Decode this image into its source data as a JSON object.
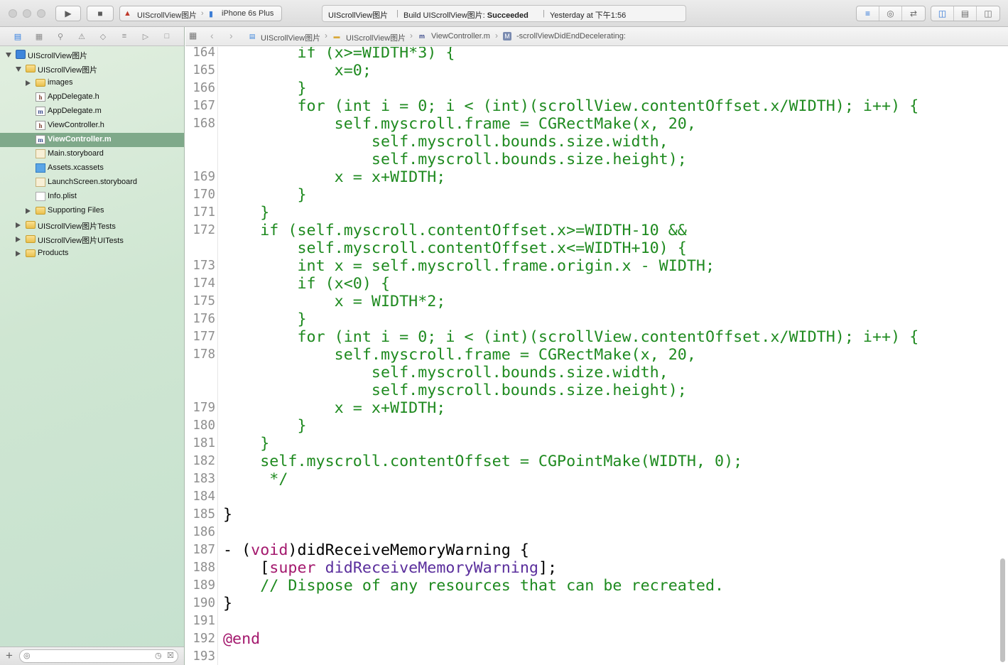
{
  "toolbar": {
    "scheme_project": "UIScrollView图片",
    "scheme_device": "iPhone 6s Plus",
    "activity_project": "UIScrollView图片",
    "activity_build_prefix": "Build UIScrollView图片: ",
    "activity_build_status": "Succeeded",
    "activity_time": "Yesterday at 下午1:56",
    "icons": [
      "run-icon",
      "stop-icon",
      "standard-editor-icon",
      "assistant-editor-icon",
      "version-editor-icon",
      "navigator-toggle-icon",
      "debug-area-toggle-icon",
      "utilities-toggle-icon"
    ]
  },
  "jumpbar": {
    "crumbs": [
      "UIScrollView图片",
      "UIScrollView图片",
      "ViewController.m",
      "-scrollViewDidEndDecelerating:"
    ]
  },
  "navigator": {
    "items": [
      {
        "label": "UIScrollView图片",
        "type": "project",
        "depth": 0,
        "disclosure": "open"
      },
      {
        "label": "UIScrollView图片",
        "type": "folder",
        "depth": 1,
        "disclosure": "open"
      },
      {
        "label": "images",
        "type": "folder",
        "depth": 2,
        "disclosure": "closed"
      },
      {
        "label": "AppDelegate.h",
        "type": "h",
        "depth": 2
      },
      {
        "label": "AppDelegate.m",
        "type": "m",
        "depth": 2
      },
      {
        "label": "ViewController.h",
        "type": "h",
        "depth": 2
      },
      {
        "label": "ViewController.m",
        "type": "m",
        "depth": 2,
        "selected": true
      },
      {
        "label": "Main.storyboard",
        "type": "storyboard",
        "depth": 2
      },
      {
        "label": "Assets.xcassets",
        "type": "assets",
        "depth": 2
      },
      {
        "label": "LaunchScreen.storyboard",
        "type": "storyboard",
        "depth": 2
      },
      {
        "label": "Info.plist",
        "type": "plist",
        "depth": 2
      },
      {
        "label": "Supporting Files",
        "type": "folder",
        "depth": 2,
        "disclosure": "closed"
      },
      {
        "label": "UIScrollView图片Tests",
        "type": "folder",
        "depth": 1,
        "disclosure": "closed"
      },
      {
        "label": "UIScrollView图片UITests",
        "type": "folder",
        "depth": 1,
        "disclosure": "closed"
      },
      {
        "label": "Products",
        "type": "folder",
        "depth": 1,
        "disclosure": "closed"
      }
    ]
  },
  "editor": {
    "lines": [
      {
        "n": "164",
        "text": "        if (x>=WIDTH*3) {"
      },
      {
        "n": "165",
        "text": "            x=0;"
      },
      {
        "n": "166",
        "text": "        }"
      },
      {
        "n": "167",
        "text": "        for (int i = 0; i < (int)(scrollView.contentOffset.x/WIDTH); i++) {"
      },
      {
        "n": "168",
        "text": "            self.myscroll.frame = CGRectMake(x, 20,"
      },
      {
        "n": "",
        "text": "                self.myscroll.bounds.size.width,"
      },
      {
        "n": "",
        "text": "                self.myscroll.bounds.size.height);"
      },
      {
        "n": "169",
        "text": "            x = x+WIDTH;"
      },
      {
        "n": "170",
        "text": "        }"
      },
      {
        "n": "171",
        "text": "    }"
      },
      {
        "n": "172",
        "text": "    if (self.myscroll.contentOffset.x>=WIDTH-10 &&"
      },
      {
        "n": "",
        "text": "        self.myscroll.contentOffset.x<=WIDTH+10) {"
      },
      {
        "n": "173",
        "text": "        int x = self.myscroll.frame.origin.x - WIDTH;"
      },
      {
        "n": "174",
        "text": "        if (x<0) {"
      },
      {
        "n": "175",
        "text": "            x = WIDTH*2;"
      },
      {
        "n": "176",
        "text": "        }"
      },
      {
        "n": "177",
        "text": "        for (int i = 0; i < (int)(scrollView.contentOffset.x/WIDTH); i++) {"
      },
      {
        "n": "178",
        "text": "            self.myscroll.frame = CGRectMake(x, 20,"
      },
      {
        "n": "",
        "text": "                self.myscroll.bounds.size.width,"
      },
      {
        "n": "",
        "text": "                self.myscroll.bounds.size.height);"
      },
      {
        "n": "179",
        "text": "            x = x+WIDTH;"
      },
      {
        "n": "180",
        "text": "        }"
      },
      {
        "n": "181",
        "text": "    }"
      },
      {
        "n": "182",
        "text": "    self.myscroll.contentOffset = CGPointMake(WIDTH, 0);"
      },
      {
        "n": "183",
        "text": "     */"
      },
      {
        "n": "184",
        "text": ""
      },
      {
        "n": "185",
        "text": "}"
      },
      {
        "n": "186",
        "text": ""
      },
      {
        "n": "187",
        "text": "- (void)didReceiveMemoryWarning {"
      },
      {
        "n": "188",
        "text": "    [super didReceiveMemoryWarning];"
      },
      {
        "n": "189",
        "text": "    // Dispose of any resources that can be recreated."
      },
      {
        "n": "190",
        "text": "}"
      },
      {
        "n": "191",
        "text": ""
      },
      {
        "n": "192",
        "text": "@end"
      },
      {
        "n": "193",
        "text": ""
      }
    ]
  },
  "colors": {
    "comment": "#1e8a1f",
    "keyword": "#a4196e",
    "system": "#5a2e9c",
    "selection": "#7fa98a",
    "accent": "#2f7de1"
  }
}
